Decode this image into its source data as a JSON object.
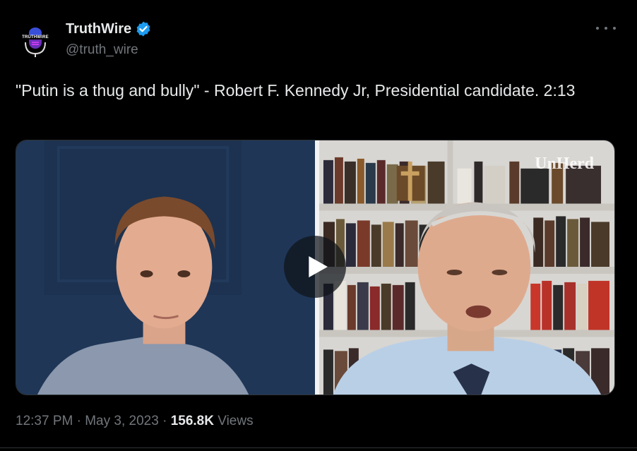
{
  "author": {
    "name": "TruthWire",
    "handle": "@truth_wire",
    "avatar_text": "TRUTHWIRE",
    "verified_color": "#1d9bf0"
  },
  "tweet": {
    "text": "\"Putin is a thug and bully\" - Robert F. Kennedy Jr, Presidential candidate. 2:13"
  },
  "media": {
    "watermark": "UnHerd",
    "play_icon": "play-icon"
  },
  "meta": {
    "time": "12:37 PM",
    "separator": " · ",
    "date": "May 3, 2023",
    "views_count": "156.8K",
    "views_label": " Views"
  },
  "colors": {
    "background": "#000000",
    "text_primary": "#e7e9ea",
    "text_secondary": "#71767b",
    "accent": "#1d9bf0"
  }
}
